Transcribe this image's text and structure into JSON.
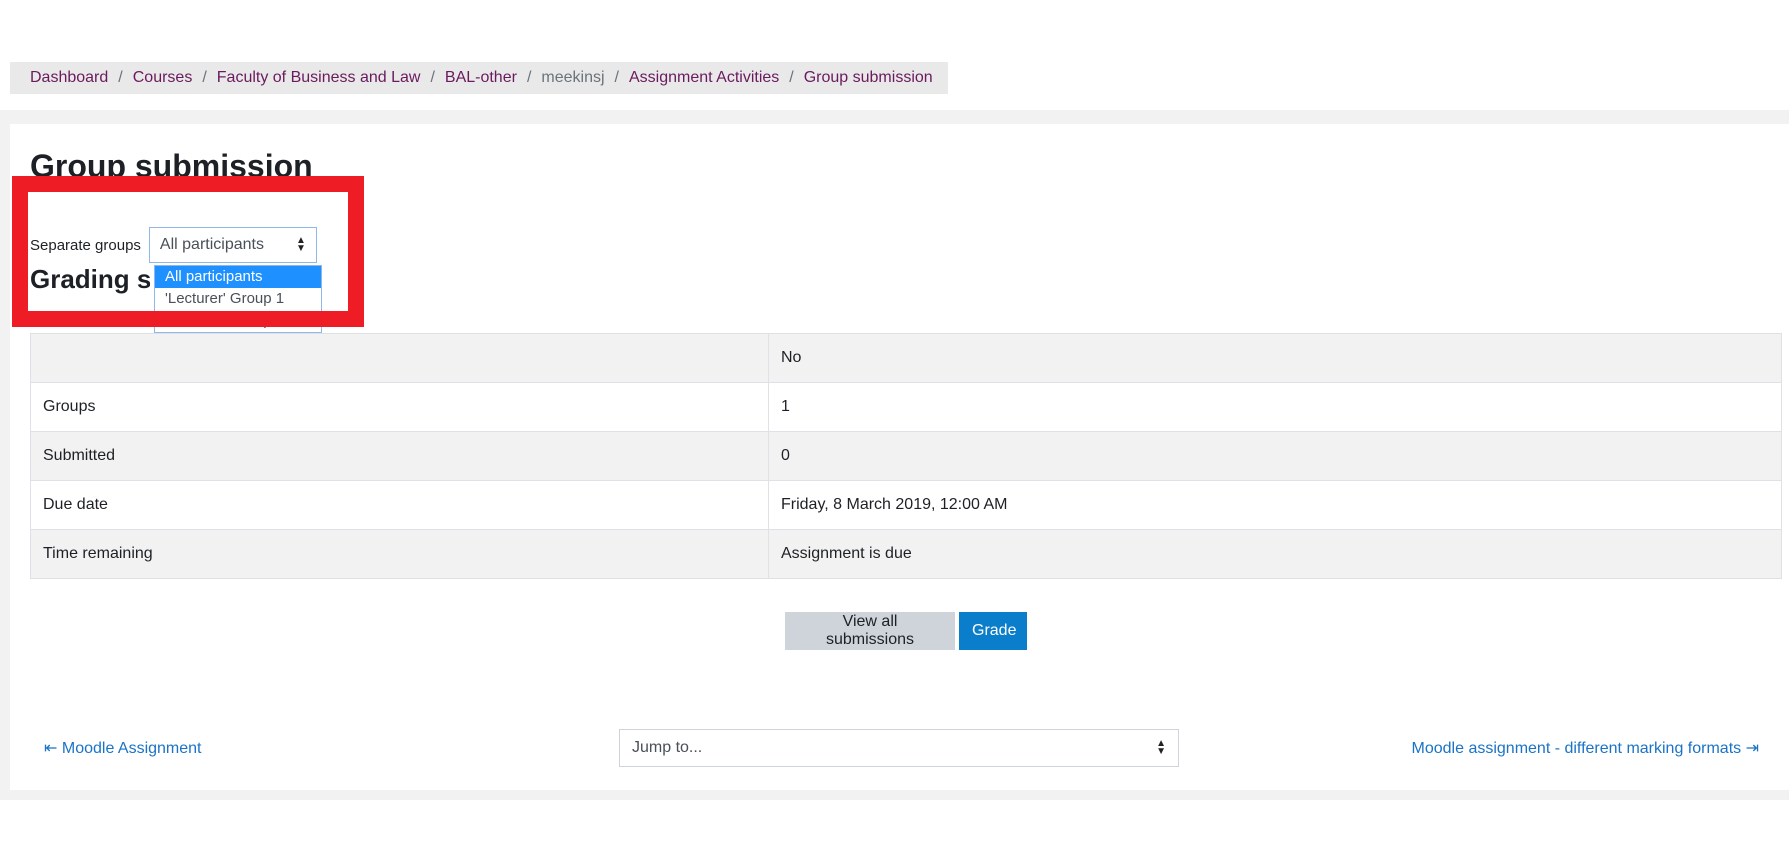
{
  "breadcrumb": [
    {
      "label": "Dashboard",
      "link": true
    },
    {
      "label": "Courses",
      "link": true
    },
    {
      "label": "Faculty of Business and Law",
      "link": true
    },
    {
      "label": "BAL-other",
      "link": true
    },
    {
      "label": "meekinsj",
      "link": false
    },
    {
      "label": "Assignment Activities",
      "link": true
    },
    {
      "label": "Group submission",
      "link": true
    }
  ],
  "page_title": "Group submission",
  "group_selector": {
    "label": "Separate groups",
    "value": "All participants",
    "options": [
      "All participants",
      "'Lecturer' Group 1",
      "'Lecturer' Group 2"
    ]
  },
  "section_title": "Grading s",
  "status_rows": [
    {
      "key": "",
      "value": "No"
    },
    {
      "key": "Groups",
      "value": "1"
    },
    {
      "key": "Submitted",
      "value": "0"
    },
    {
      "key": "Due date",
      "value": "Friday, 8 March 2019, 12:00 AM"
    },
    {
      "key": "Time remaining",
      "value": "Assignment is due"
    }
  ],
  "buttons": {
    "view_all": "View all submissions",
    "grade": "Grade"
  },
  "footer": {
    "prev_label": "Moodle Assignment",
    "prev_icon": "arrow-left-bar-icon",
    "next_label": "Moodle assignment - different marking formats",
    "next_icon": "arrow-right-bar-icon",
    "jump_placeholder": "Jump to..."
  },
  "colors": {
    "highlight": "#ee1c25",
    "link": "#1a73c7",
    "breadcrumb_link": "#6a1b5e",
    "primary_button": "#0a7ecb",
    "selected_option": "#1e90ff"
  }
}
